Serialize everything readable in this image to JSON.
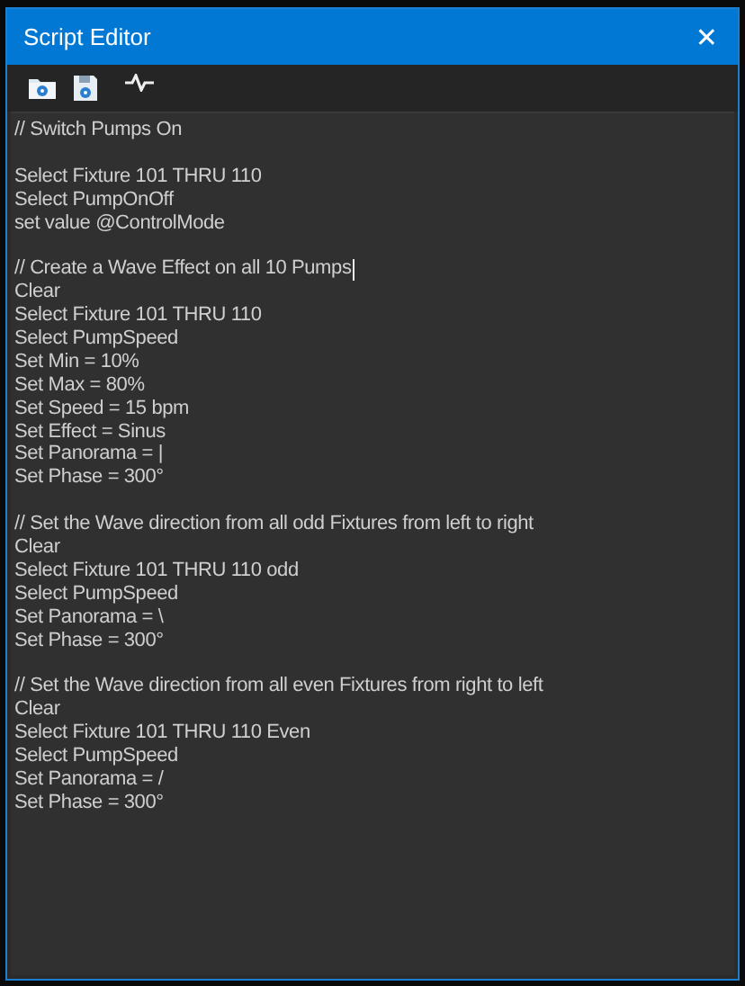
{
  "window": {
    "title": "Script Editor",
    "close": "✕"
  },
  "script": [
    {
      "lines": [
        {
          "text": "// Switch Pumps On",
          "caret": false
        }
      ]
    },
    {
      "lines": [
        {
          "text": "Select Fixture 101 THRU 110",
          "caret": false
        },
        {
          "text": "Select PumpOnOff",
          "caret": false
        },
        {
          "text": "set value @ControlMode",
          "caret": false
        }
      ]
    },
    {
      "lines": [
        {
          "text": "// Create a Wave Effect on all 10 Pumps",
          "caret": true
        },
        {
          "text": "Clear",
          "caret": false
        },
        {
          "text": "Select Fixture 101 THRU 110",
          "caret": false
        },
        {
          "text": "Select PumpSpeed",
          "caret": false
        },
        {
          "text": "Set Min = 10%",
          "caret": false
        },
        {
          "text": "Set Max = 80%",
          "caret": false
        },
        {
          "text": "Set Speed = 15 bpm",
          "caret": false
        },
        {
          "text": "Set Effect = Sinus",
          "caret": false
        },
        {
          "text": "Set Panorama = |",
          "caret": false
        },
        {
          "text": "Set Phase = 300°",
          "caret": false
        }
      ]
    },
    {
      "lines": [
        {
          "text": "// Set the Wave direction from all odd Fixtures from left to right",
          "caret": false
        },
        {
          "text": "Clear",
          "caret": false
        },
        {
          "text": "Select Fixture 101 THRU 110 odd",
          "caret": false
        },
        {
          "text": "Select PumpSpeed",
          "caret": false
        },
        {
          "text": "Set Panorama = \\",
          "caret": false
        },
        {
          "text": "Set Phase = 300°",
          "caret": false
        }
      ]
    },
    {
      "lines": [
        {
          "text": "// Set the Wave direction from all even Fixtures from right to left",
          "caret": false
        },
        {
          "text": "Clear",
          "caret": false
        },
        {
          "text": "Select Fixture 101 THRU 110 Even",
          "caret": false
        },
        {
          "text": "Select PumpSpeed",
          "caret": false
        },
        {
          "text": "Set Panorama = /",
          "caret": false
        },
        {
          "text": "Set Phase = 300°",
          "caret": false
        }
      ]
    }
  ]
}
